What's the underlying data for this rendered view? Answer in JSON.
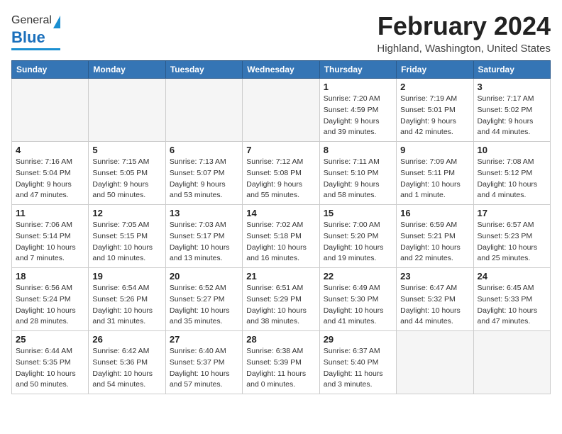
{
  "header": {
    "logo_general": "General",
    "logo_blue": "Blue",
    "month_year": "February 2024",
    "location": "Highland, Washington, United States"
  },
  "days_of_week": [
    "Sunday",
    "Monday",
    "Tuesday",
    "Wednesday",
    "Thursday",
    "Friday",
    "Saturday"
  ],
  "weeks": [
    [
      {
        "day": "",
        "info": ""
      },
      {
        "day": "",
        "info": ""
      },
      {
        "day": "",
        "info": ""
      },
      {
        "day": "",
        "info": ""
      },
      {
        "day": "1",
        "info": "Sunrise: 7:20 AM\nSunset: 4:59 PM\nDaylight: 9 hours\nand 39 minutes."
      },
      {
        "day": "2",
        "info": "Sunrise: 7:19 AM\nSunset: 5:01 PM\nDaylight: 9 hours\nand 42 minutes."
      },
      {
        "day": "3",
        "info": "Sunrise: 7:17 AM\nSunset: 5:02 PM\nDaylight: 9 hours\nand 44 minutes."
      }
    ],
    [
      {
        "day": "4",
        "info": "Sunrise: 7:16 AM\nSunset: 5:04 PM\nDaylight: 9 hours\nand 47 minutes."
      },
      {
        "day": "5",
        "info": "Sunrise: 7:15 AM\nSunset: 5:05 PM\nDaylight: 9 hours\nand 50 minutes."
      },
      {
        "day": "6",
        "info": "Sunrise: 7:13 AM\nSunset: 5:07 PM\nDaylight: 9 hours\nand 53 minutes."
      },
      {
        "day": "7",
        "info": "Sunrise: 7:12 AM\nSunset: 5:08 PM\nDaylight: 9 hours\nand 55 minutes."
      },
      {
        "day": "8",
        "info": "Sunrise: 7:11 AM\nSunset: 5:10 PM\nDaylight: 9 hours\nand 58 minutes."
      },
      {
        "day": "9",
        "info": "Sunrise: 7:09 AM\nSunset: 5:11 PM\nDaylight: 10 hours\nand 1 minute."
      },
      {
        "day": "10",
        "info": "Sunrise: 7:08 AM\nSunset: 5:12 PM\nDaylight: 10 hours\nand 4 minutes."
      }
    ],
    [
      {
        "day": "11",
        "info": "Sunrise: 7:06 AM\nSunset: 5:14 PM\nDaylight: 10 hours\nand 7 minutes."
      },
      {
        "day": "12",
        "info": "Sunrise: 7:05 AM\nSunset: 5:15 PM\nDaylight: 10 hours\nand 10 minutes."
      },
      {
        "day": "13",
        "info": "Sunrise: 7:03 AM\nSunset: 5:17 PM\nDaylight: 10 hours\nand 13 minutes."
      },
      {
        "day": "14",
        "info": "Sunrise: 7:02 AM\nSunset: 5:18 PM\nDaylight: 10 hours\nand 16 minutes."
      },
      {
        "day": "15",
        "info": "Sunrise: 7:00 AM\nSunset: 5:20 PM\nDaylight: 10 hours\nand 19 minutes."
      },
      {
        "day": "16",
        "info": "Sunrise: 6:59 AM\nSunset: 5:21 PM\nDaylight: 10 hours\nand 22 minutes."
      },
      {
        "day": "17",
        "info": "Sunrise: 6:57 AM\nSunset: 5:23 PM\nDaylight: 10 hours\nand 25 minutes."
      }
    ],
    [
      {
        "day": "18",
        "info": "Sunrise: 6:56 AM\nSunset: 5:24 PM\nDaylight: 10 hours\nand 28 minutes."
      },
      {
        "day": "19",
        "info": "Sunrise: 6:54 AM\nSunset: 5:26 PM\nDaylight: 10 hours\nand 31 minutes."
      },
      {
        "day": "20",
        "info": "Sunrise: 6:52 AM\nSunset: 5:27 PM\nDaylight: 10 hours\nand 35 minutes."
      },
      {
        "day": "21",
        "info": "Sunrise: 6:51 AM\nSunset: 5:29 PM\nDaylight: 10 hours\nand 38 minutes."
      },
      {
        "day": "22",
        "info": "Sunrise: 6:49 AM\nSunset: 5:30 PM\nDaylight: 10 hours\nand 41 minutes."
      },
      {
        "day": "23",
        "info": "Sunrise: 6:47 AM\nSunset: 5:32 PM\nDaylight: 10 hours\nand 44 minutes."
      },
      {
        "day": "24",
        "info": "Sunrise: 6:45 AM\nSunset: 5:33 PM\nDaylight: 10 hours\nand 47 minutes."
      }
    ],
    [
      {
        "day": "25",
        "info": "Sunrise: 6:44 AM\nSunset: 5:35 PM\nDaylight: 10 hours\nand 50 minutes."
      },
      {
        "day": "26",
        "info": "Sunrise: 6:42 AM\nSunset: 5:36 PM\nDaylight: 10 hours\nand 54 minutes."
      },
      {
        "day": "27",
        "info": "Sunrise: 6:40 AM\nSunset: 5:37 PM\nDaylight: 10 hours\nand 57 minutes."
      },
      {
        "day": "28",
        "info": "Sunrise: 6:38 AM\nSunset: 5:39 PM\nDaylight: 11 hours\nand 0 minutes."
      },
      {
        "day": "29",
        "info": "Sunrise: 6:37 AM\nSunset: 5:40 PM\nDaylight: 11 hours\nand 3 minutes."
      },
      {
        "day": "",
        "info": ""
      },
      {
        "day": "",
        "info": ""
      }
    ]
  ]
}
